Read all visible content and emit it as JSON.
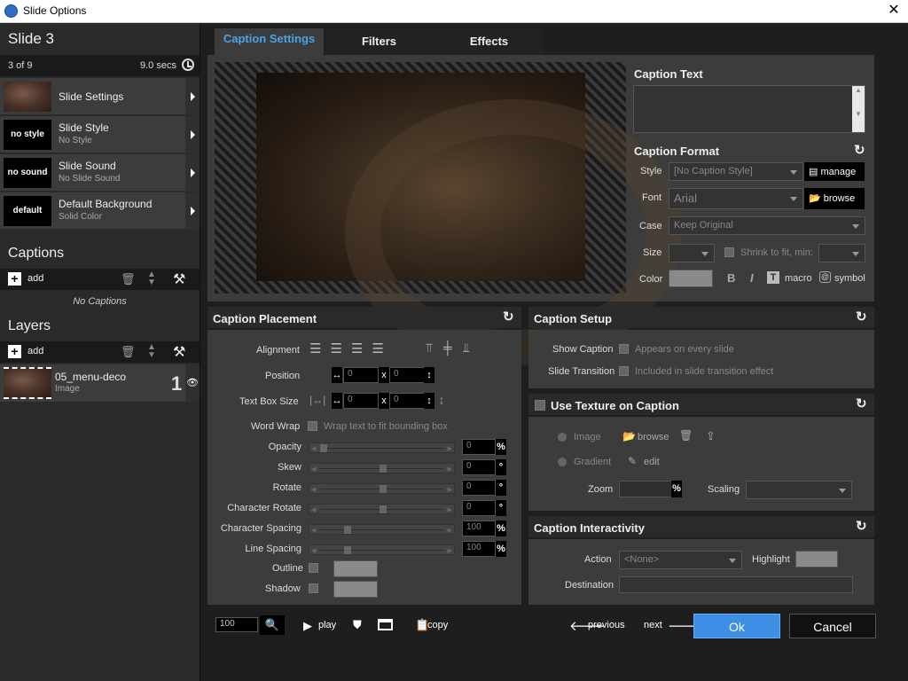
{
  "window": {
    "title": "Slide Options",
    "close": "✕"
  },
  "left": {
    "slide_title": "Slide 3",
    "count": "3 of 9",
    "duration": "9.0 secs",
    "items": [
      {
        "label": "Slide Settings",
        "sub": "",
        "thumb": ""
      },
      {
        "label": "Slide Style",
        "sub": "No Style",
        "thumb": "no style"
      },
      {
        "label": "Slide Sound",
        "sub": "No Slide Sound",
        "thumb": "no sound"
      },
      {
        "label": "Default Background",
        "sub": "Solid Color",
        "thumb": "default"
      }
    ],
    "captions_title": "Captions",
    "add_label": "add",
    "no_captions": "No Captions",
    "layers_title": "Layers",
    "layer": {
      "name": "05_menu-deco",
      "type": "Image",
      "number": "1"
    }
  },
  "tabs": [
    "Caption Settings",
    "Filters",
    "Effects"
  ],
  "caption_text": {
    "title": "Caption Text",
    "value": ""
  },
  "caption_format": {
    "title": "Caption Format",
    "style_label": "Style",
    "style_value": "[No Caption Style]",
    "manage": "manage",
    "font_label": "Font",
    "font_value": "Arial",
    "browse": "browse",
    "case_label": "Case",
    "case_value": "Keep Original",
    "size_label": "Size",
    "shrink_label": "Shrink to fit, min:",
    "color_label": "Color",
    "macro": "macro",
    "symbol": "symbol"
  },
  "placement": {
    "title": "Caption Placement",
    "alignment": "Alignment",
    "position": "Position",
    "textbox": "Text Box Size",
    "pos_x": "0",
    "pos_y": "0",
    "box_w": "0",
    "box_h": "0",
    "x_sep": "x",
    "wordwrap": "Word Wrap",
    "wordwrap_desc": "Wrap text to fit bounding box",
    "sliders": [
      {
        "label": "Opacity",
        "value": "0",
        "unit": "%",
        "level": 0
      },
      {
        "label": "Skew",
        "value": "0",
        "unit": "°",
        "level": 0.5
      },
      {
        "label": "Rotate",
        "value": "0",
        "unit": "°",
        "level": 0.5
      },
      {
        "label": "Character Rotate",
        "value": "0",
        "unit": "°",
        "level": 0.5
      },
      {
        "label": "Character Spacing",
        "value": "100",
        "unit": "%",
        "level": 0.2
      },
      {
        "label": "Line Spacing",
        "value": "100",
        "unit": "%",
        "level": 0.2
      }
    ],
    "outline": "Outline",
    "shadow": "Shadow"
  },
  "setup": {
    "title": "Caption Setup",
    "show_caption": "Show Caption",
    "show_desc": "Appears on every slide",
    "transition": "Slide Transition",
    "transition_desc": "Included in slide transition effect"
  },
  "texture": {
    "title": "Use Texture on Caption",
    "image": "Image",
    "browse": "browse",
    "gradient": "Gradient",
    "edit": "edit",
    "zoom": "Zoom",
    "zoom_unit": "%",
    "scaling": "Scaling"
  },
  "interactivity": {
    "title": "Caption Interactivity",
    "action": "Action",
    "action_value": "<None>",
    "highlight": "Highlight",
    "destination": "Destination"
  },
  "footer": {
    "zoom": "100",
    "play": "play",
    "copy": "copy",
    "previous": "previous",
    "next": "next",
    "ok": "Ok",
    "cancel": "Cancel"
  }
}
